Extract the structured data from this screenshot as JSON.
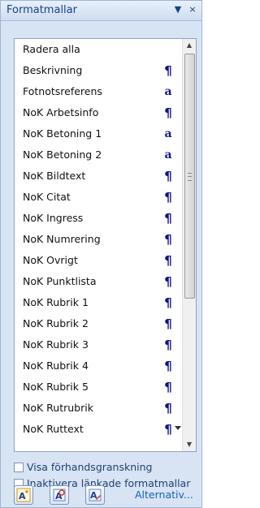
{
  "pane": {
    "title": "Formatmallar",
    "menu_glyph": "▼",
    "close_glyph": "×"
  },
  "styles": [
    {
      "name": "Radera alla",
      "mark": ""
    },
    {
      "name": "Beskrivning",
      "mark": "¶"
    },
    {
      "name": "Fotnotsreferens",
      "mark": "a"
    },
    {
      "name": "NoK Arbetsinfo",
      "mark": "¶"
    },
    {
      "name": "NoK Betoning 1",
      "mark": "a"
    },
    {
      "name": "NoK Betoning 2",
      "mark": "a"
    },
    {
      "name": "NoK Bildtext",
      "mark": "¶"
    },
    {
      "name": "NoK Citat",
      "mark": "¶"
    },
    {
      "name": "NoK Ingress",
      "mark": "¶"
    },
    {
      "name": "NoK Numrering",
      "mark": "¶"
    },
    {
      "name": "NoK Ovrigt",
      "mark": "¶"
    },
    {
      "name": "NoK Punktlista",
      "mark": "¶"
    },
    {
      "name": "NoK Rubrik 1",
      "mark": "¶"
    },
    {
      "name": "NoK Rubrik 2",
      "mark": "¶"
    },
    {
      "name": "NoK Rubrik 3",
      "mark": "¶"
    },
    {
      "name": "NoK Rubrik 4",
      "mark": "¶"
    },
    {
      "name": "NoK Rubrik 5",
      "mark": "¶"
    },
    {
      "name": "NoK Rutrubrik",
      "mark": "¶"
    },
    {
      "name": "NoK Ruttext",
      "mark": "¶"
    }
  ],
  "options": {
    "show_preview_label": "Visa förhandsgranskning",
    "disable_linked_label": "Inaktivera länkade formatmallar",
    "show_preview_checked": false,
    "disable_linked_checked": false
  },
  "buttons": {
    "new_style_icon": "new-style-icon",
    "style_inspector_icon": "style-inspector-icon",
    "manage_styles_icon": "manage-styles-icon",
    "alternatives_label": "Alternativ..."
  },
  "colors": {
    "pane_bg": "#d8e4f3",
    "title_text": "#15428b",
    "mark_color": "#11138a",
    "link_color": "#1560b8"
  }
}
